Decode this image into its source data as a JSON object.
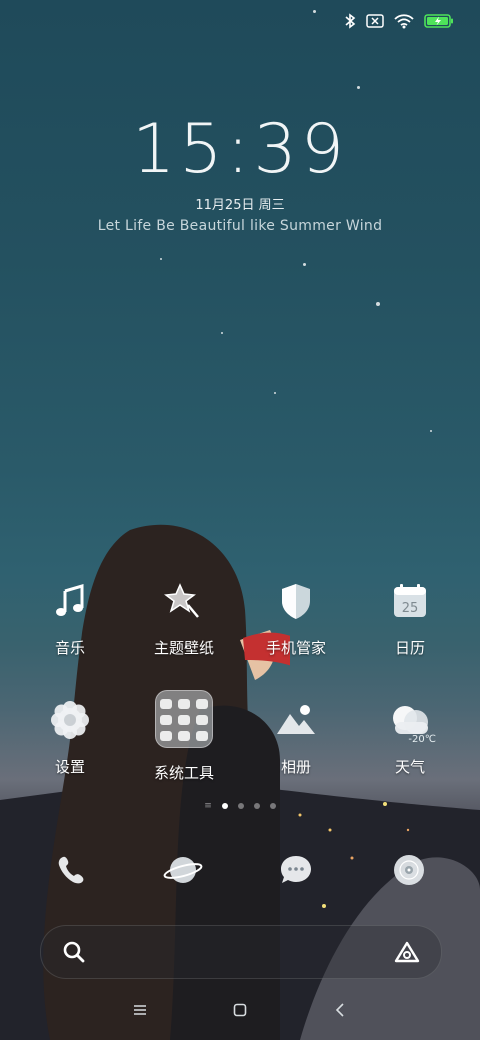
{
  "status_bar": {
    "icons": [
      "bluetooth-icon",
      "sim-disabled-icon",
      "wifi-icon",
      "battery-charging-icon"
    ]
  },
  "lockscreen": {
    "time": "15:39",
    "date": "11月25日 周三",
    "quote": "Let Life Be Beautiful like Summer Wind"
  },
  "apps": [
    {
      "label": "音乐",
      "icon": "music-icon"
    },
    {
      "label": "主题壁纸",
      "icon": "theme-star-icon"
    },
    {
      "label": "手机管家",
      "icon": "shield-icon"
    },
    {
      "label": "日历",
      "icon": "calendar-icon",
      "day": "25"
    },
    {
      "label": "设置",
      "icon": "gear-icon"
    },
    {
      "label": "系统工具",
      "icon": "folder-icon"
    },
    {
      "label": "相册",
      "icon": "gallery-icon"
    },
    {
      "label": "天气",
      "icon": "weather-icon",
      "temp": "-20℃"
    }
  ],
  "pager": {
    "pages": 4,
    "active": 0
  },
  "dock": [
    {
      "name": "phone",
      "icon": "phone-icon"
    },
    {
      "name": "browser",
      "icon": "planet-icon"
    },
    {
      "name": "messages",
      "icon": "chat-icon"
    },
    {
      "name": "music-disc",
      "icon": "disc-icon"
    }
  ],
  "search_bar": {
    "left_icon": "search-icon",
    "right_icon": "assistant-icon"
  },
  "nav_bar": {
    "icons": [
      "menu-icon",
      "home-icon",
      "back-icon"
    ]
  },
  "colors": {
    "sky_top": "#1f4a5a",
    "text": "#ffffff"
  }
}
